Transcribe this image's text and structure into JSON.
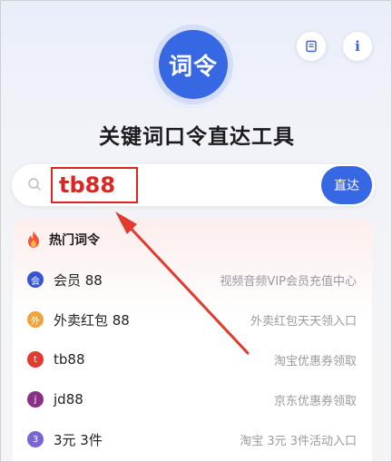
{
  "logo": {
    "text": "词令"
  },
  "top_buttons": {
    "note_icon": "note-icon",
    "info_label": "i"
  },
  "title": "关键词口令直达工具",
  "search": {
    "value": "tb88",
    "go_label": "直达"
  },
  "hot": {
    "title": "热门词令",
    "items": [
      {
        "badge": "会",
        "name": "会员 88",
        "desc": "视频音频VIP会员充值中心",
        "color": "#3656cf"
      },
      {
        "badge": "外",
        "name": "外卖红包 88",
        "desc": "外卖红包天天领入口",
        "color": "#f2a23b"
      },
      {
        "badge": "t",
        "name": "tb88",
        "desc": "淘宝优惠券领取",
        "color": "#e23a2e"
      },
      {
        "badge": "j",
        "name": "jd88",
        "desc": "京东优惠券领取",
        "color": "#8a2f86"
      },
      {
        "badge": "3",
        "name": "3元 3件",
        "desc": "淘宝 3元 3件活动入口",
        "color": "#7b63d8"
      }
    ]
  },
  "colors": {
    "accent": "#3768e3",
    "highlight": "#e02424"
  }
}
